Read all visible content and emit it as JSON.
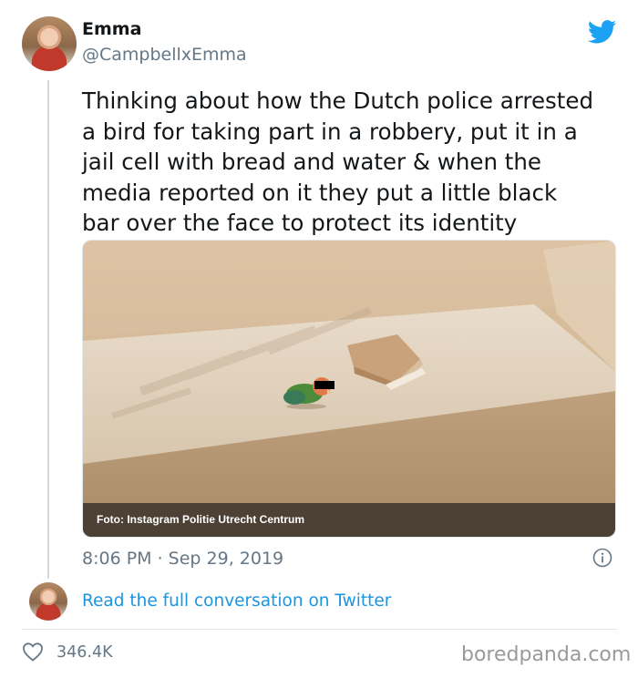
{
  "author": {
    "name": "Emma",
    "handle": "@CampbellxEmma"
  },
  "tweet": {
    "text": "Thinking about how the Dutch police arrested\na bird for taking part in a robbery, put it in a\njail cell with bread and water & when the\nmedia reported on it they put a little black\nbar over the face to protect its identity",
    "timestamp": "8:06 PM · Sep 29, 2019",
    "photo_caption": "Foto: Instagram Politie Utrecht Centrum"
  },
  "footer": {
    "read_link": "Read the full conversation on Twitter",
    "likes": "346.4K",
    "watermark": "boredpanda.com"
  },
  "icons": {
    "logo": "twitter-bird-icon",
    "info": "info-icon",
    "like": "heart-icon"
  },
  "colors": {
    "twitter_blue": "#1da1f2",
    "link_blue": "#1b95e0",
    "secondary_text": "#657786"
  }
}
